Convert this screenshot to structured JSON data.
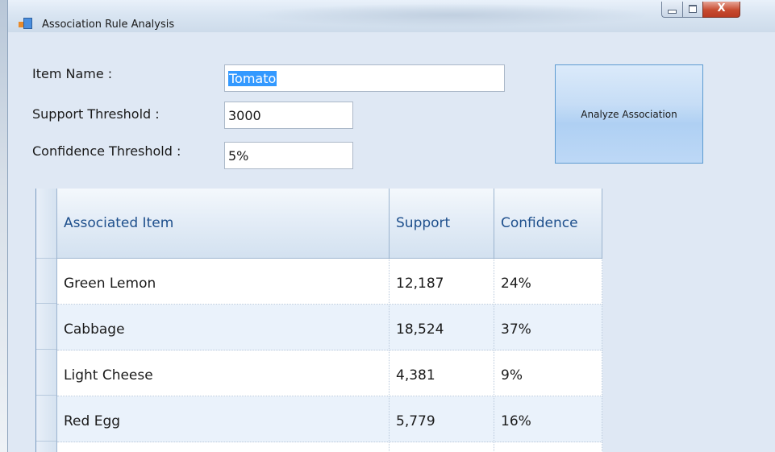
{
  "window": {
    "title": "Association Rule Analysis",
    "caption": {
      "minimize": "minimize",
      "maximize": "maximize",
      "close": "X"
    }
  },
  "form": {
    "item_name_label": "Item Name :",
    "item_name_value": "Tomato",
    "support_label": "Support Threshold :",
    "support_value": "3000",
    "confidence_label": "Confidence Threshold :",
    "confidence_value": "5%",
    "analyze_button": "Analyze Association"
  },
  "table": {
    "columns": [
      "Associated Item",
      "Support",
      "Confidence"
    ],
    "rows": [
      [
        "Green Lemon",
        "12,187",
        "24%"
      ],
      [
        "Cabbage",
        "18,524",
        "37%"
      ],
      [
        "Light Cheese",
        "4,381",
        "9%"
      ],
      [
        "Red Egg",
        "5,779",
        "16%"
      ]
    ]
  },
  "colors": {
    "header_text": "#1e4f8c",
    "selection": "#3399ff",
    "button_border": "#5d9bd1",
    "alt_row": "#eaf2fb"
  }
}
